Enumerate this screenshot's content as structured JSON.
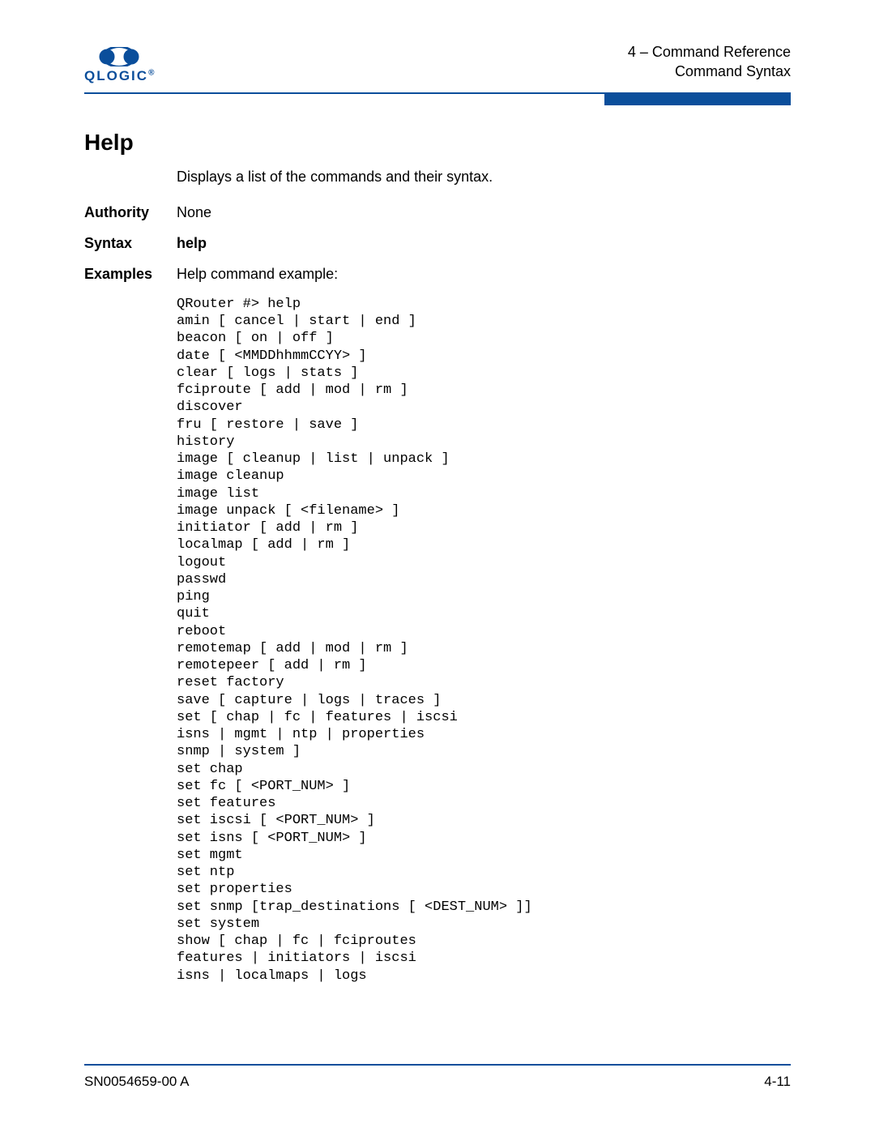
{
  "header": {
    "logo_name": "QLOGIC",
    "chapter": "4 – Command Reference",
    "subtitle": "Command Syntax"
  },
  "section": {
    "title": "Help",
    "intro": "Displays a list of the commands and their syntax.",
    "rows": {
      "authority_label": "Authority",
      "authority_value": "None",
      "syntax_label": "Syntax",
      "syntax_value": "help",
      "examples_label": "Examples",
      "examples_value": "Help command example:"
    },
    "code": "QRouter #> help\namin [ cancel | start | end ]\nbeacon [ on | off ]\ndate [ <MMDDhhmmCCYY> ]\nclear [ logs | stats ]\nfciproute [ add | mod | rm ]\ndiscover\nfru [ restore | save ]\nhistory\nimage [ cleanup | list | unpack ]\nimage cleanup\nimage list\nimage unpack [ <filename> ]\ninitiator [ add | rm ]\nlocalmap [ add | rm ]\nlogout\npasswd\nping\nquit\nreboot\nremotemap [ add | mod | rm ]\nremotepeer [ add | rm ]\nreset factory\nsave [ capture | logs | traces ]\nset [ chap | fc | features | iscsi\nisns | mgmt | ntp | properties\nsnmp | system ]\nset chap\nset fc [ <PORT_NUM> ]\nset features\nset iscsi [ <PORT_NUM> ]\nset isns [ <PORT_NUM> ]\nset mgmt\nset ntp\nset properties\nset snmp [trap_destinations [ <DEST_NUM> ]]\nset system\nshow [ chap | fc | fciproutes\nfeatures | initiators | iscsi\nisns | localmaps | logs"
  },
  "footer": {
    "doc_number": "SN0054659-00 A",
    "page_number": "4-11"
  },
  "colors": {
    "brand": "#0a4e9b"
  }
}
